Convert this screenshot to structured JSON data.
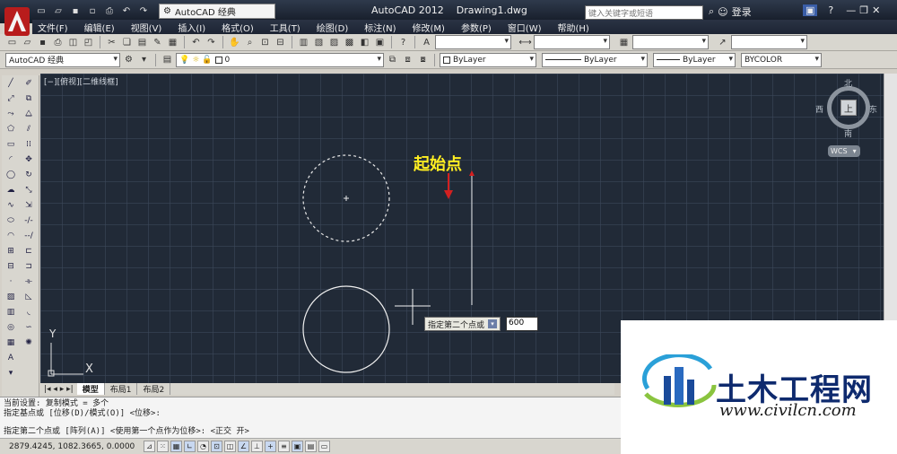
{
  "window": {
    "app_title": "AutoCAD 2012",
    "document_title": "Drawing1.dwg",
    "search_placeholder": "键入关键字或短语",
    "login_label": "登录",
    "help_icon": "?"
  },
  "workspace": {
    "selected": "AutoCAD 经典"
  },
  "menu": {
    "items": [
      "文件(F)",
      "编辑(E)",
      "视图(V)",
      "插入(I)",
      "格式(O)",
      "工具(T)",
      "绘图(D)",
      "标注(N)",
      "修改(M)",
      "参数(P)",
      "窗口(W)",
      "帮助(H)"
    ]
  },
  "toolbar2": {
    "workspace_combo": "AutoCAD 经典",
    "layer_value": "0"
  },
  "properties": {
    "color": "ByLayer",
    "linetype": "ByLayer",
    "lineweight": "ByLayer",
    "plotstyle": "BYCOLOR"
  },
  "viewport": {
    "label": "[−][俯视][二维线框]",
    "compass": {
      "north": "北",
      "south": "南",
      "east": "东",
      "west": "西"
    },
    "cube_face": "上",
    "wcs_label": "WCS",
    "ucs_y": "Y",
    "ucs_x": "X"
  },
  "annotation": {
    "start_point": "起始点",
    "color": "#ffee22"
  },
  "dynamic_input": {
    "prompt": "指定第二个点或",
    "value": "600"
  },
  "layout_tabs": [
    "模型",
    "布局1",
    "布局2"
  ],
  "command_line": {
    "lines": [
      "当前设置:  复制模式 = 多个",
      "指定基点或 [位移(D)/模式(O)] <位移>:"
    ],
    "prompt": "指定第二个点或 [阵列(A)] <使用第一个点作为位移>: <正交 开>"
  },
  "status_bar": {
    "coordinates": "2879.4245, 1082.3665, 0.0000"
  },
  "watermark": {
    "title": "土木工程网",
    "url": "www.civilcn.com"
  },
  "colors": {
    "canvas_bg": "#212a37",
    "accent_red": "#d32020",
    "brand_blue": "#0e2a6e"
  }
}
